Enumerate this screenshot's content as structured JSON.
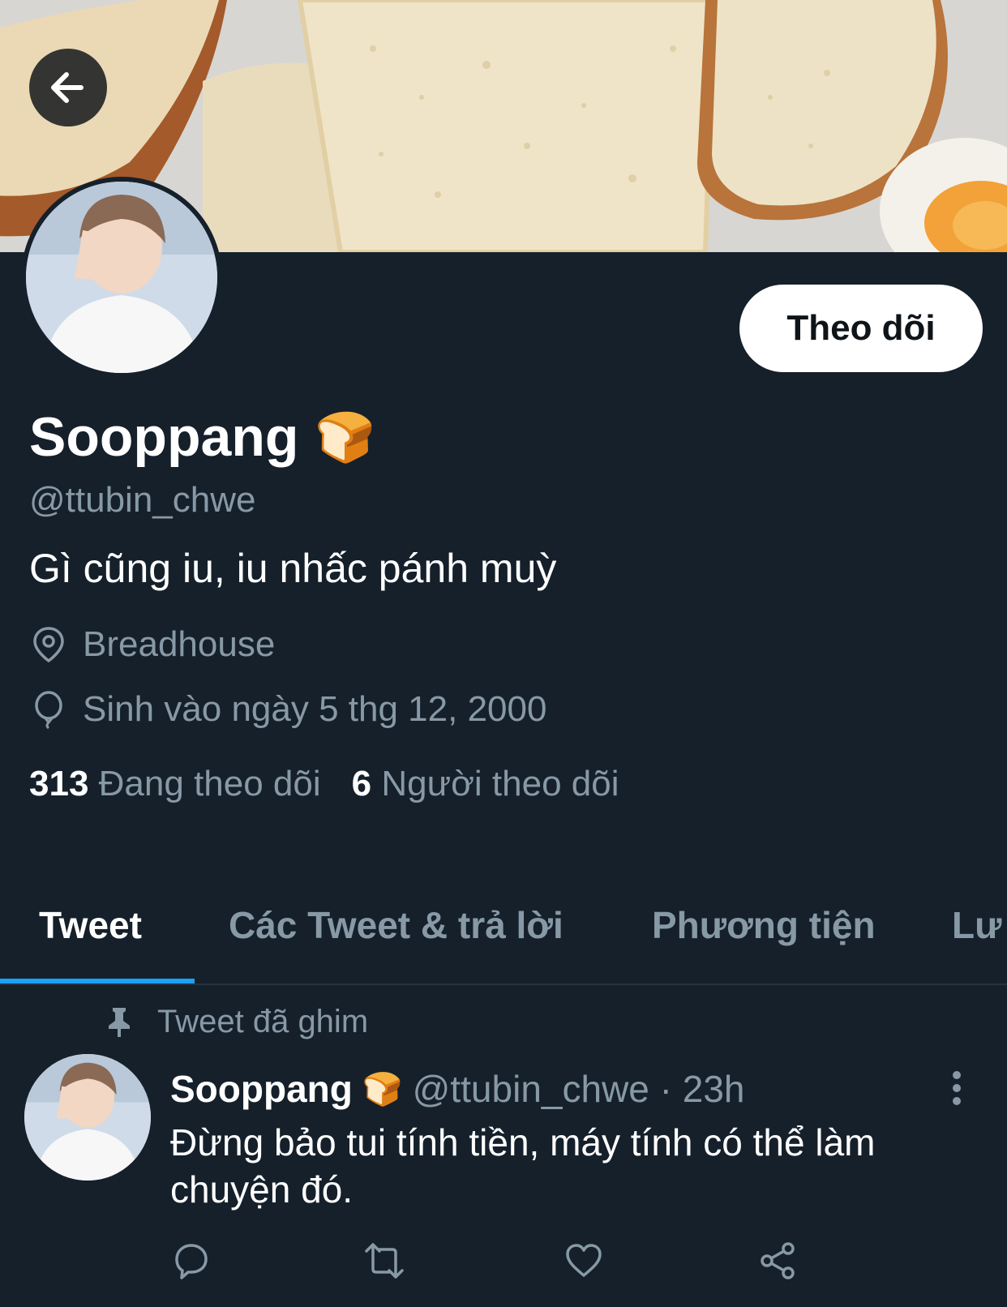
{
  "profile": {
    "name": "Sooppang",
    "name_emoji": "🍞",
    "handle": "@ttubin_chwe",
    "bio": "Gì cũng iu, iu nhấc pánh muỳ",
    "location": "Breadhouse",
    "birthday": "Sinh vào ngày 5 thg 12, 2000",
    "following_count": "313",
    "following_label": "Đang theo dõi",
    "followers_count": "6",
    "followers_label": "Người theo dõi"
  },
  "follow_button": {
    "label": "Theo dõi"
  },
  "tabs": [
    {
      "label": "Tweet",
      "active": true
    },
    {
      "label": "Các Tweet & trả lời",
      "active": false
    },
    {
      "label": "Phương tiện",
      "active": false
    },
    {
      "label": "Lư",
      "active": false
    }
  ],
  "pinned": {
    "label": "Tweet đã ghim",
    "author": "Sooppang",
    "author_emoji": "🍞",
    "meta": "@ttubin_chwe · 23h",
    "text": "Đừng bảo tui tính tiền, máy tính có thể làm chuyện đó."
  },
  "icons": {
    "back": "arrow-left-icon",
    "location": "location-pin-icon",
    "birthday": "balloon-icon",
    "pin": "pin-icon",
    "more": "more-vertical-icon",
    "reply": "reply-icon",
    "retweet": "retweet-icon",
    "like": "heart-icon",
    "share": "share-icon"
  },
  "colors": {
    "background": "#15202b",
    "secondary_text": "#8899a6",
    "accent": "#1da1f2"
  }
}
